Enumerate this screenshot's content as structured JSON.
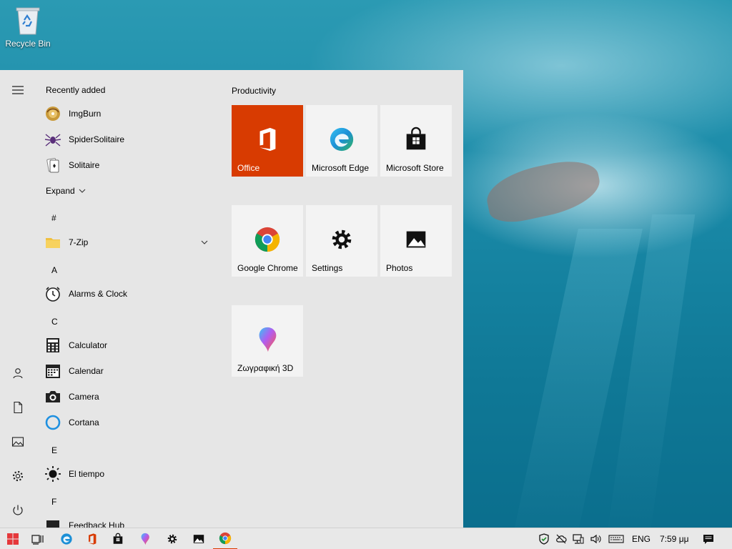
{
  "desktop": {
    "icons": [
      {
        "label": "Recycle Bin",
        "icon": "recycle-bin-icon"
      }
    ]
  },
  "start_menu": {
    "rail": [
      {
        "name": "hamburger-menu",
        "icon": "menu-icon"
      },
      {
        "name": "user",
        "icon": "user-icon"
      },
      {
        "name": "documents",
        "icon": "document-icon"
      },
      {
        "name": "pictures",
        "icon": "image-icon"
      },
      {
        "name": "settings",
        "icon": "gear-icon"
      },
      {
        "name": "power",
        "icon": "power-icon"
      }
    ],
    "recently_added_label": "Recently added",
    "recent_apps": [
      {
        "label": "ImgBurn",
        "icon": "imgburn-icon"
      },
      {
        "label": "SpiderSolitaire",
        "icon": "spider-icon"
      },
      {
        "label": "Solitaire",
        "icon": "cards-icon"
      }
    ],
    "expand_label": "Expand",
    "letters": {
      "hash": "#",
      "a": "A",
      "c": "C",
      "e": "E",
      "f": "F"
    },
    "apps": {
      "zip": {
        "label": "7-Zip",
        "icon": "folder-icon"
      },
      "alarms": {
        "label": "Alarms & Clock",
        "icon": "alarm-clock-icon"
      },
      "calculator": {
        "label": "Calculator",
        "icon": "calculator-icon"
      },
      "calendar": {
        "label": "Calendar",
        "icon": "calendar-icon"
      },
      "camera": {
        "label": "Camera",
        "icon": "camera-icon"
      },
      "cortana": {
        "label": "Cortana",
        "icon": "cortana-ring-icon"
      },
      "weather": {
        "label": "El tiempo",
        "icon": "sun-icon"
      },
      "feedback": {
        "label": "Feedback Hub",
        "icon": "feedback-icon"
      }
    },
    "tiles": {
      "group_title": "Productivity",
      "items": [
        {
          "label": "Office",
          "icon": "office-icon",
          "color": "#d83b01"
        },
        {
          "label": "Microsoft Edge",
          "icon": "edge-icon"
        },
        {
          "label": "Microsoft Store",
          "icon": "store-bag-icon"
        },
        {
          "label": "Google Chrome",
          "icon": "chrome-icon"
        },
        {
          "label": "Settings",
          "icon": "gear-icon"
        },
        {
          "label": "Photos",
          "icon": "photos-icon"
        },
        {
          "label": "Ζωγραφική 3D",
          "icon": "paint3d-icon"
        }
      ]
    }
  },
  "taskbar": {
    "pinned": [
      {
        "name": "start",
        "icon": "windows-logo-icon"
      },
      {
        "name": "task-view",
        "icon": "task-view-icon"
      },
      {
        "name": "edge",
        "icon": "edge-icon"
      },
      {
        "name": "office",
        "icon": "office-icon"
      },
      {
        "name": "store",
        "icon": "store-bag-icon"
      },
      {
        "name": "paint3d",
        "icon": "paint3d-icon"
      },
      {
        "name": "settings",
        "icon": "gear-icon"
      },
      {
        "name": "photos",
        "icon": "photos-icon"
      },
      {
        "name": "chrome",
        "icon": "chrome-icon",
        "active": true
      }
    ],
    "tray": {
      "language": "ENG",
      "time": "7:59 μμ"
    }
  }
}
